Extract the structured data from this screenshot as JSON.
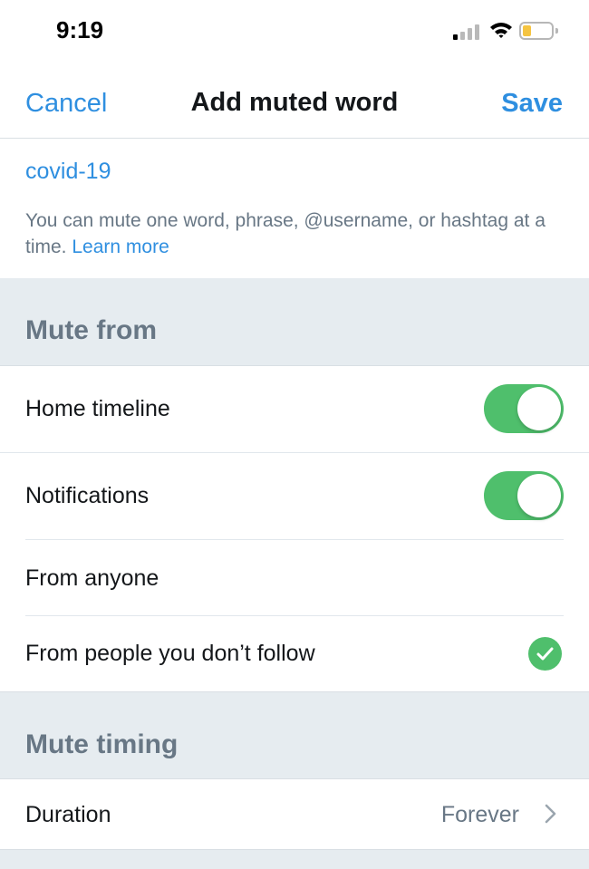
{
  "status_bar": {
    "time": "9:19",
    "signal_icon": "cellular-signal-icon",
    "wifi_icon": "wifi-icon",
    "battery_icon": "battery-icon",
    "battery_level": 0.3,
    "battery_color": "#f5c441"
  },
  "nav": {
    "cancel_label": "Cancel",
    "title": "Add muted word",
    "save_label": "Save"
  },
  "word": {
    "value": "covid-19",
    "hint": "You can mute one word, phrase, @username, or hashtag at a time.",
    "learn_more": "Learn more"
  },
  "mute_from": {
    "header": "Mute from",
    "home_timeline": {
      "label": "Home timeline",
      "enabled": true
    },
    "notifications": {
      "label": "Notifications",
      "enabled": true
    },
    "from_anyone": {
      "label": "From anyone",
      "selected": false
    },
    "from_non_followers": {
      "label": "From people you don’t follow",
      "selected": true
    }
  },
  "mute_timing": {
    "header": "Mute timing",
    "duration_label": "Duration",
    "duration_value": "Forever"
  },
  "colors": {
    "accent": "#2f8fe0",
    "toggle_on": "#4fbf6c",
    "section_bg": "#e6ecf0",
    "secondary_text": "#687785"
  }
}
